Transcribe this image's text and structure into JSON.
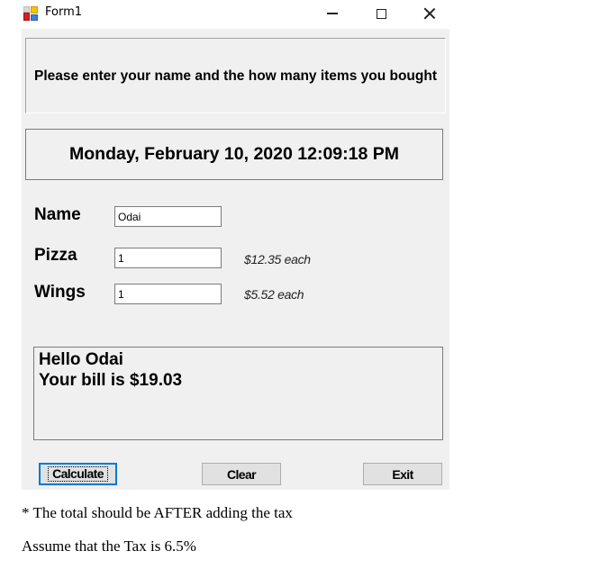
{
  "window": {
    "title": "Form1",
    "icon": "winforms-app-icon",
    "controls": {
      "minimize": "minimize-icon",
      "maximize": "maximize-icon",
      "close": "close-icon"
    }
  },
  "form": {
    "instruction": "Please enter your name and the how many items you bought",
    "datetime": "Monday, February 10, 2020 12:09:18 PM",
    "fields": {
      "name": {
        "label": "Name",
        "value": "Odai"
      },
      "pizza": {
        "label": "Pizza",
        "value": "1",
        "price": "$12.35 each"
      },
      "wings": {
        "label": "Wings",
        "value": "1",
        "price": "$5.52 each"
      }
    },
    "output": {
      "line1": "Hello Odai",
      "line2": "Your bill is $19.03"
    },
    "buttons": {
      "calculate": "Calculate",
      "clear": "Clear",
      "exit": "Exit"
    }
  },
  "notes": {
    "line1": "* The total should be AFTER adding the tax",
    "line2": "Assume that the Tax is 6.5%"
  }
}
